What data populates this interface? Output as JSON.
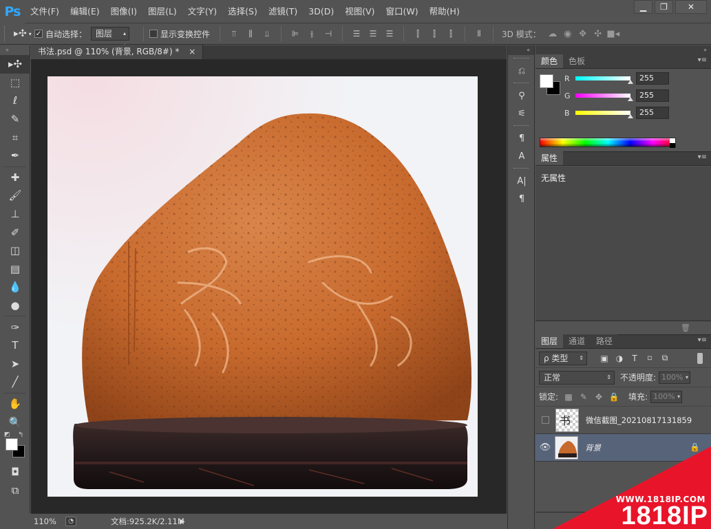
{
  "app": {
    "logo": "Ps"
  },
  "menu": [
    "文件(F)",
    "编辑(E)",
    "图像(I)",
    "图层(L)",
    "文字(Y)",
    "选择(S)",
    "滤镜(T)",
    "3D(D)",
    "视图(V)",
    "窗口(W)",
    "帮助(H)"
  ],
  "window_controls": {
    "minimize": "▁",
    "maximize": "❐",
    "close": "✕"
  },
  "options": {
    "auto_select_checked": "✓",
    "auto_select_label": "自动选择：",
    "auto_select_target": "图层",
    "show_transform_label": "显示变换控件",
    "mode_3d_label": "3D 模式："
  },
  "document": {
    "tab_title": "书法.psd @ 110% (背景, RGB/8#) *",
    "tab_close": "×"
  },
  "status": {
    "zoom": "110%",
    "doc_info": "文档:925.2K/2.11M"
  },
  "color_panel": {
    "tabs": [
      "颜色",
      "色板"
    ],
    "channels": [
      {
        "name": "R",
        "value": "255",
        "gradient_from": "#00ffff",
        "gradient_to": "#ffffff"
      },
      {
        "name": "G",
        "value": "255",
        "gradient_from": "#ff00ff",
        "gradient_to": "#ffffff"
      },
      {
        "name": "B",
        "value": "255",
        "gradient_from": "#ffff00",
        "gradient_to": "#ffffff"
      }
    ],
    "foreground": "#ffffff",
    "background": "#000000"
  },
  "properties_panel": {
    "tab": "属性",
    "body_text": "无属性"
  },
  "layers_panel": {
    "tabs": [
      "图层",
      "通道",
      "路径"
    ],
    "filter_label": "ρ 类型",
    "blend_mode": "正常",
    "opacity_label": "不透明度:",
    "opacity_value": "100%",
    "lock_label": "锁定:",
    "fill_label": "填充:",
    "fill_value": "100%",
    "layers": [
      {
        "name": "微信截图_20210817131859",
        "visible": false,
        "selected": false,
        "locked": false
      },
      {
        "name": "背景",
        "visible": true,
        "selected": true,
        "locked": true
      }
    ]
  },
  "watermark": {
    "url": "WWW.1818IP.COM",
    "brand": "1818IP",
    "color": "#e8152a"
  }
}
